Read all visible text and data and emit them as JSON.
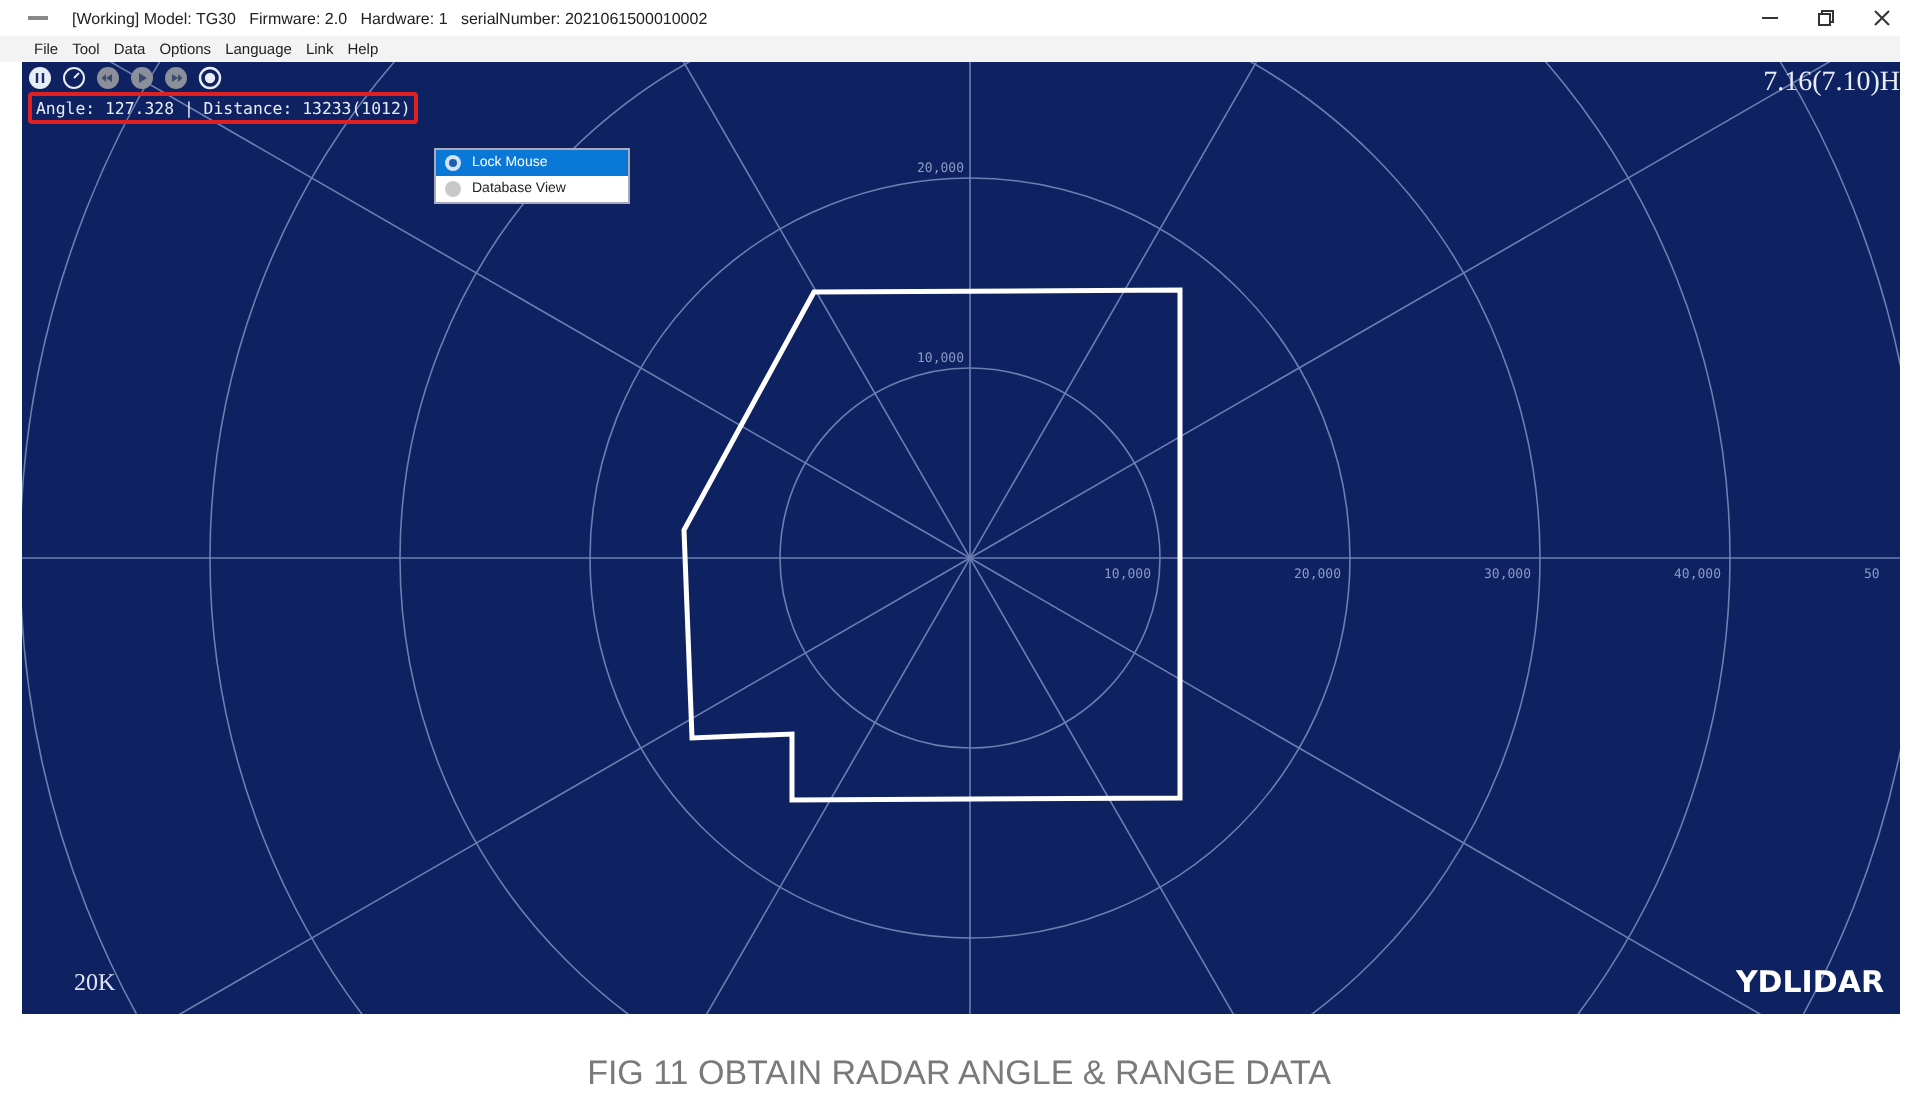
{
  "window": {
    "title": "[Working] Model: TG30   Firmware: 2.0   Hardware: 1   serialNumber: 2021061500010002"
  },
  "menu_bar": [
    "File",
    "Tool",
    "Data",
    "Options",
    "Language",
    "Link",
    "Help"
  ],
  "toolbar": [
    {
      "kind": "pause",
      "disabled": false
    },
    {
      "kind": "gauge",
      "disabled": false
    },
    {
      "kind": "rewind",
      "disabled": true
    },
    {
      "kind": "play",
      "disabled": true
    },
    {
      "kind": "forward",
      "disabled": true
    },
    {
      "kind": "record",
      "disabled": false
    }
  ],
  "readout": "Angle: 127.328 | Distance: 13233(1012)",
  "frequency": "7.16(7.10)H",
  "context_menu": [
    {
      "label": "Lock Mouse",
      "selected": true
    },
    {
      "label": "Database View",
      "selected": false
    }
  ],
  "range_labels_horizontal": [
    "10,000",
    "20,000",
    "30,000",
    "40,000",
    "50"
  ],
  "range_labels_vertical": [
    "20,000",
    "10,000"
  ],
  "scale": "20K",
  "logo": "YDLIDAR",
  "caption": "FIG 11 OBTAIN RADAR ANGLE & RANGE DATA"
}
